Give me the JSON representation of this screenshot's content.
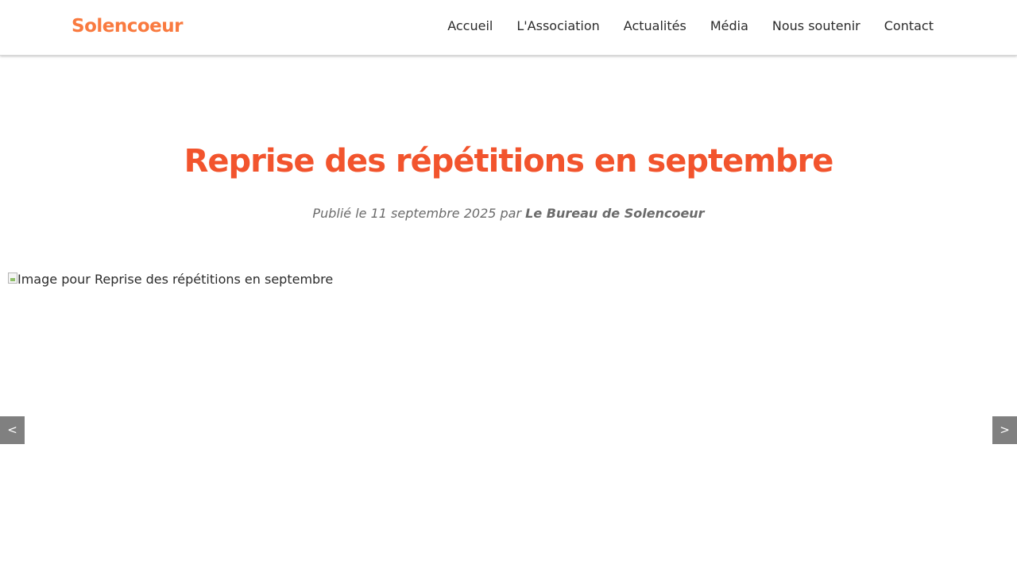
{
  "header": {
    "logo": "Solencoeur",
    "nav": [
      {
        "label": "Accueil"
      },
      {
        "label": "L'Association"
      },
      {
        "label": "Actualités"
      },
      {
        "label": "Média"
      },
      {
        "label": "Nous soutenir"
      },
      {
        "label": "Contact"
      }
    ]
  },
  "article": {
    "title": "Reprise des répétitions en septembre",
    "meta_prefix": "Publié le 11 septembre 2025 par ",
    "author": "Le Bureau de Solencoeur",
    "image_alt": "Image pour Reprise des répétitions en septembre"
  },
  "carousel": {
    "prev_label": "<",
    "next_label": ">"
  },
  "colors": {
    "brand": "#f97a3f",
    "title": "#f2542d",
    "arrow_bg": "#808080"
  }
}
